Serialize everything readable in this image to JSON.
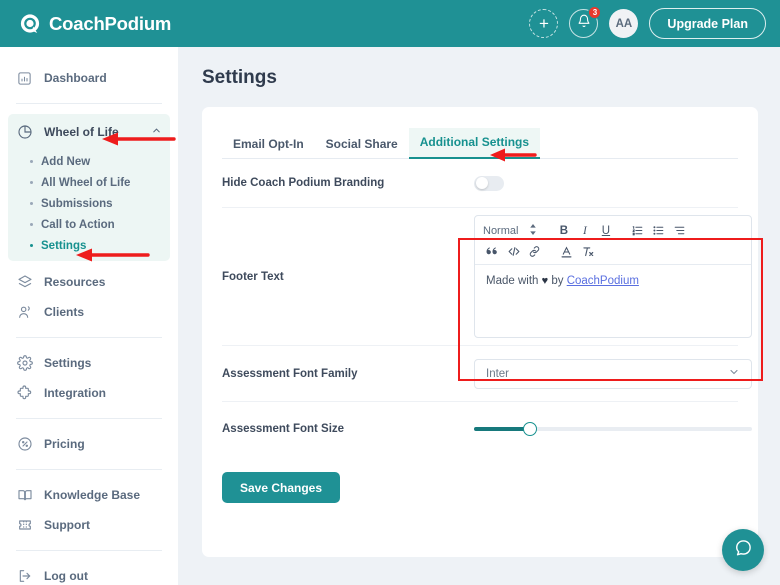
{
  "header": {
    "brand_name": "CoachPodium",
    "brand_icon": "speech-bubble-logo",
    "add_icon": "plus-icon",
    "notification_icon": "bell-icon",
    "notification_count": "3",
    "avatar_initials": "AA",
    "upgrade_label": "Upgrade Plan"
  },
  "sidebar": {
    "dashboard": {
      "label": "Dashboard",
      "icon": "chart-bar-icon"
    },
    "group": {
      "label": "Wheel of Life",
      "icon": "pie-chart-icon",
      "chevron": "chevron-up-icon",
      "items": [
        {
          "label": "Add New"
        },
        {
          "label": "All Wheel of Life"
        },
        {
          "label": "Submissions"
        },
        {
          "label": "Call to Action"
        },
        {
          "label": "Settings"
        }
      ]
    },
    "items": [
      {
        "label": "Resources",
        "icon": "layers-icon"
      },
      {
        "label": "Clients",
        "icon": "users-icon"
      },
      {
        "label": "Settings",
        "icon": "gear-icon"
      },
      {
        "label": "Integration",
        "icon": "puzzle-icon"
      },
      {
        "label": "Pricing",
        "icon": "percent-badge-icon"
      },
      {
        "label": "Knowledge Base",
        "icon": "book-icon"
      },
      {
        "label": "Support",
        "icon": "ticket-icon"
      },
      {
        "label": "Log out",
        "icon": "logout-icon"
      }
    ]
  },
  "main": {
    "page_title": "Settings",
    "tabs": [
      {
        "label": "Email Opt-In"
      },
      {
        "label": "Social Share"
      },
      {
        "label": "Additional Settings"
      }
    ],
    "branding_row": {
      "label": "Hide Coach Podium Branding",
      "toggle_state": "off"
    },
    "footer_row": {
      "label": "Footer Text",
      "toolbar": {
        "format_label": "Normal",
        "format_chevron": "updown-arrows-icon",
        "bold": "B",
        "italic": "I",
        "underline": "U",
        "ordered_list": "ordered-list-icon",
        "bullet_list": "bullet-list-icon",
        "indent": "indent-icon",
        "blockquote": "quote-icon",
        "code": "code-icon",
        "link": "link-icon",
        "text_color": "text-color-icon",
        "clear_format": "clear-format-icon"
      },
      "content_prefix": "Made with ",
      "content_heart": "♥",
      "content_middle": " by ",
      "content_link": "CoachPodium"
    },
    "font_family_row": {
      "label": "Assessment Font Family",
      "value": "Inter",
      "chevron": "chevron-down-icon"
    },
    "font_size_row": {
      "label": "Assessment Font Size",
      "percent": 20
    },
    "save_label": "Save Changes"
  },
  "help_widget": {
    "icon": "chat-bubble-icon"
  },
  "colors": {
    "brand_teal": "#1f9195",
    "accent_teal": "#17918f",
    "badge_red": "#e8392d",
    "annotation_red": "#ee1c1c",
    "page_bg": "#eef2f6",
    "link_blue": "#5a6fe0"
  }
}
